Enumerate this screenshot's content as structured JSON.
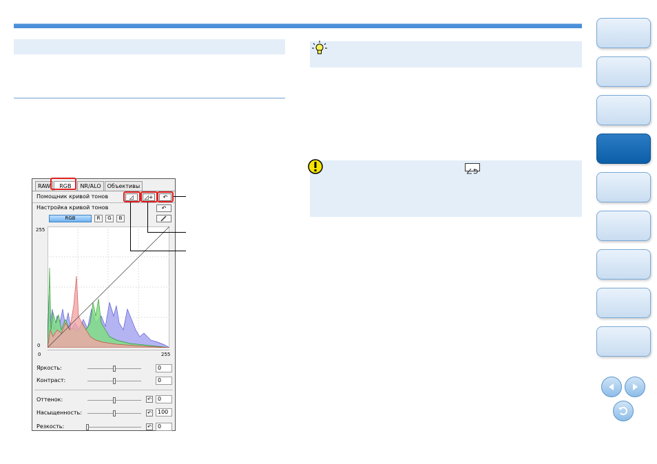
{
  "panel": {
    "tabs": [
      "RAW",
      "RGB",
      "NR/ALO",
      "Объективы"
    ],
    "tone_curve_assist_label": "Помощник кривой тонов",
    "tone_curve_adjust_label": "Настройка кривой тонов",
    "channels": [
      "RGB",
      "R",
      "G",
      "B"
    ],
    "axis_top": "255",
    "axis_bottom": "0",
    "axis_x_left": "0",
    "axis_x_right": "255",
    "brightness_label": "Яркость:",
    "brightness_value": "0",
    "contrast_label": "Контраст:",
    "contrast_value": "0",
    "hue_label": "Оттенок:",
    "hue_value": "0",
    "saturation_label": "Насыщенность:",
    "saturation_value": "100",
    "sharpness_label": "Резкость:",
    "sharpness_value": "0",
    "slider_levels": {
      "brightness": 0.5,
      "contrast": 0.5,
      "hue": 0.5,
      "saturation": 0.5,
      "sharpness": 0.0
    }
  },
  "colors": {
    "accent": "#4a90d9",
    "box_bg": "#e3eef8",
    "nav_active": "#0b5ea8",
    "highlight": "#e02020"
  },
  "icons": {
    "tip": "lightbulb-icon",
    "warning": "exclamation-icon",
    "reset": "reset-curve-icon"
  }
}
